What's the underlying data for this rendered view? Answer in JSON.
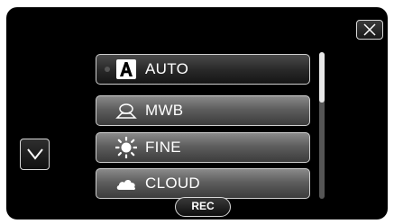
{
  "menu": {
    "items": [
      {
        "label": "AUTO",
        "icon": "auto-a-icon",
        "selected": true
      },
      {
        "label": "MWB",
        "icon": "manual-white-balance-icon",
        "selected": false
      },
      {
        "label": "FINE",
        "icon": "sun-icon",
        "selected": false
      },
      {
        "label": "CLOUD",
        "icon": "cloud-icon",
        "selected": false
      }
    ]
  },
  "controls": {
    "rec_label": "REC",
    "close_icon": "close-icon",
    "down_icon": "chevron-down-icon"
  },
  "scroll": {
    "position_fraction": 0.0,
    "visible_fraction": 0.34
  },
  "colors": {
    "screen_bg": "#000000",
    "button_border": "#cfcfcf",
    "text": "#ffffff"
  }
}
